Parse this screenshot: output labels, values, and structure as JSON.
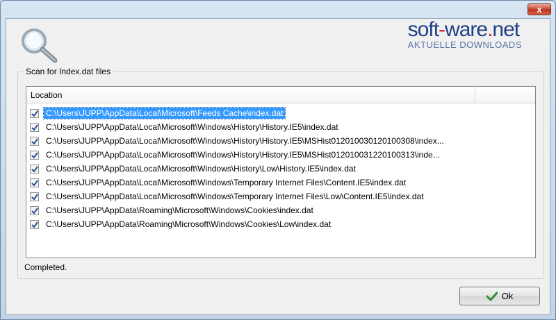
{
  "window": {
    "close_label": "x"
  },
  "watermark": {
    "brand_prefix": "soft",
    "brand_dash": "-",
    "brand_mid": "ware",
    "brand_dot": ".",
    "brand_suffix": "net",
    "tagline": "AKTUELLE DOWNLOADS"
  },
  "group": {
    "label": "Scan for Index.dat files"
  },
  "listview": {
    "column_location": "Location",
    "rows": [
      {
        "path": "C:\\Users\\JUPP\\AppData\\Local\\Microsoft\\Feeds Cache\\index.dat",
        "checked": true,
        "selected": true
      },
      {
        "path": "C:\\Users\\JUPP\\AppData\\Local\\Microsoft\\Windows\\History\\History.IE5\\index.dat",
        "checked": true,
        "selected": false
      },
      {
        "path": "C:\\Users\\JUPP\\AppData\\Local\\Microsoft\\Windows\\History\\History.IE5\\MSHist012010030120100308\\index...",
        "checked": true,
        "selected": false
      },
      {
        "path": "C:\\Users\\JUPP\\AppData\\Local\\Microsoft\\Windows\\History\\History.IE5\\MSHist012010031220100313\\inde...",
        "checked": true,
        "selected": false
      },
      {
        "path": "C:\\Users\\JUPP\\AppData\\Local\\Microsoft\\Windows\\History\\Low\\History.IE5\\index.dat",
        "checked": true,
        "selected": false
      },
      {
        "path": "C:\\Users\\JUPP\\AppData\\Local\\Microsoft\\Windows\\Temporary Internet Files\\Content.IE5\\index.dat",
        "checked": true,
        "selected": false
      },
      {
        "path": "C:\\Users\\JUPP\\AppData\\Local\\Microsoft\\Windows\\Temporary Internet Files\\Low\\Content.IE5\\index.dat",
        "checked": true,
        "selected": false
      },
      {
        "path": "C:\\Users\\JUPP\\AppData\\Roaming\\Microsoft\\Windows\\Cookies\\index.dat",
        "checked": true,
        "selected": false
      },
      {
        "path": "C:\\Users\\JUPP\\AppData\\Roaming\\Microsoft\\Windows\\Cookies\\Low\\index.dat",
        "checked": true,
        "selected": false
      }
    ]
  },
  "status": {
    "text": "Completed."
  },
  "ok_button": {
    "label": "Ok",
    "icon": "checkmark-icon"
  }
}
